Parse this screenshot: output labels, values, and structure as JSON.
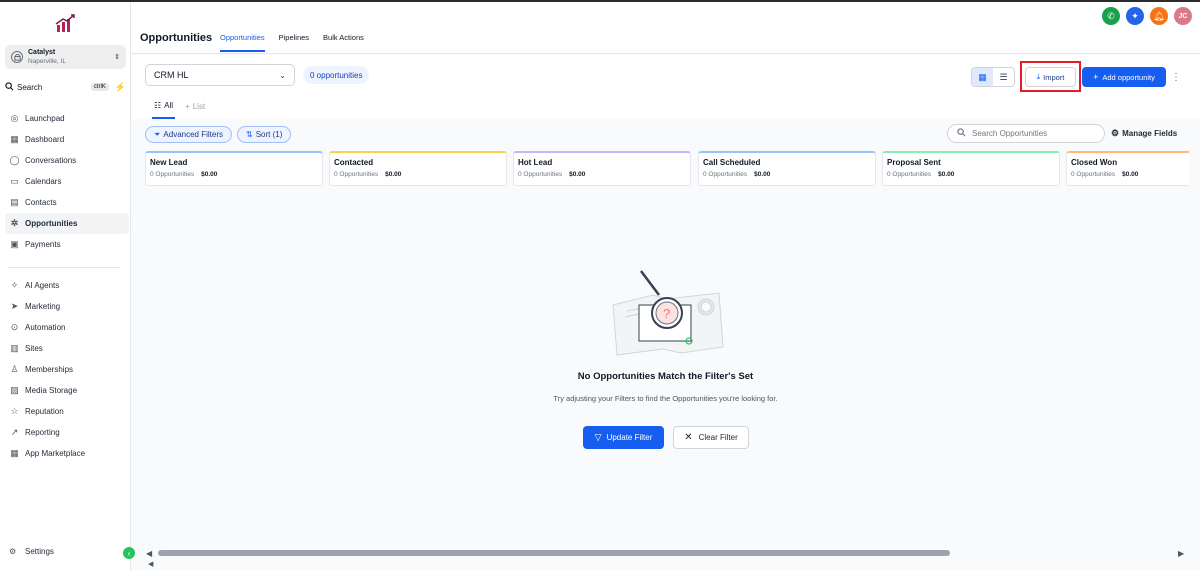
{
  "sidebar": {
    "account": {
      "name": "Catalyst",
      "location": "Naperville, IL"
    },
    "search": {
      "label": "Search",
      "shortcut": "ctrlK"
    },
    "items": [
      {
        "label": "Launchpad",
        "icon": "launchpad-icon"
      },
      {
        "label": "Dashboard",
        "icon": "dashboard-icon"
      },
      {
        "label": "Conversations",
        "icon": "conversations-icon"
      },
      {
        "label": "Calendars",
        "icon": "calendar-icon"
      },
      {
        "label": "Contacts",
        "icon": "contacts-icon"
      },
      {
        "label": "Opportunities",
        "icon": "opportunities-icon",
        "active": true
      },
      {
        "label": "Payments",
        "icon": "payments-icon"
      }
    ],
    "items2": [
      {
        "label": "AI Agents",
        "icon": "ai-agents-icon"
      },
      {
        "label": "Marketing",
        "icon": "marketing-icon"
      },
      {
        "label": "Automation",
        "icon": "automation-icon"
      },
      {
        "label": "Sites",
        "icon": "sites-icon"
      },
      {
        "label": "Memberships",
        "icon": "memberships-icon"
      },
      {
        "label": "Media Storage",
        "icon": "media-storage-icon"
      },
      {
        "label": "Reputation",
        "icon": "reputation-icon"
      },
      {
        "label": "Reporting",
        "icon": "reporting-icon"
      },
      {
        "label": "App Marketplace",
        "icon": "app-marketplace-icon"
      }
    ],
    "settings_label": "Settings"
  },
  "header": {
    "title": "Opportunities",
    "tabs": [
      {
        "label": "Opportunities",
        "active": true
      },
      {
        "label": "Pipelines"
      },
      {
        "label": "Bulk Actions"
      }
    ],
    "avatar_initials": "JC"
  },
  "toolbar": {
    "pipeline": "CRM HL",
    "count_label": "0 opportunities",
    "import_label": "Import",
    "add_label": "Add opportunity",
    "subtabs": {
      "all": "All",
      "list": "List"
    },
    "advanced_filters": "Advanced Filters",
    "sort": "Sort (1)",
    "search_placeholder": "Search Opportunities",
    "manage_fields": "Manage Fields"
  },
  "stages": [
    {
      "name": "New Lead",
      "count": "0 Opportunities",
      "amount": "$0.00"
    },
    {
      "name": "Contacted",
      "count": "0 Opportunities",
      "amount": "$0.00"
    },
    {
      "name": "Hot Lead",
      "count": "0 Opportunities",
      "amount": "$0.00"
    },
    {
      "name": "Call Scheduled",
      "count": "0 Opportunities",
      "amount": "$0.00"
    },
    {
      "name": "Proposal Sent",
      "count": "0 Opportunities",
      "amount": "$0.00"
    },
    {
      "name": "Closed Won",
      "count": "0 Opportunities",
      "amount": "$0.00"
    }
  ],
  "empty_state": {
    "title": "No Opportunities Match the Filter's Set",
    "description": "Try adjusting your Filters to find the Opportunities you're looking for.",
    "update_filter": "Update Filter",
    "clear_filter": "Clear Filter"
  },
  "colors": {
    "accent": "#155eef",
    "highlight": "#e11d2a",
    "stage_tops": [
      "#93c5fd",
      "#fcd34d",
      "#c4b5fd",
      "#93c5fd",
      "#86efac",
      "#fdba74"
    ]
  }
}
